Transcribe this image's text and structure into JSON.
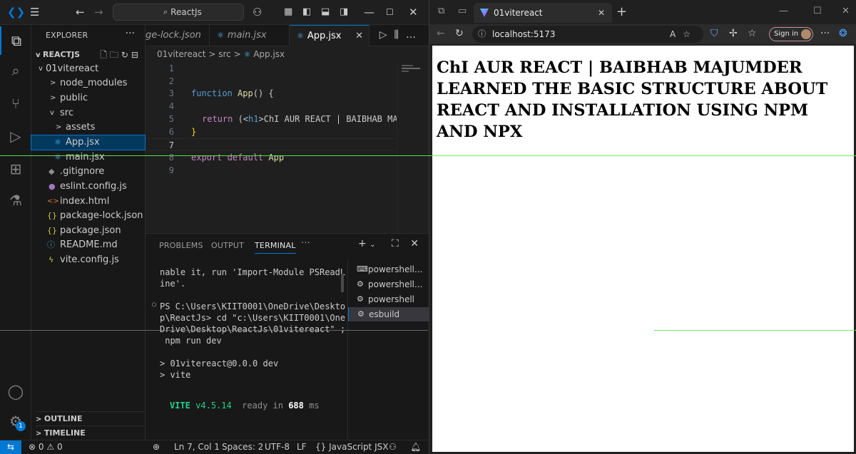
{
  "vscode": {
    "search": "ReactJs",
    "activity_icons": [
      "explorer-icon",
      "search-icon",
      "source-control-icon",
      "run-debug-icon",
      "extensions-icon",
      "testing-icon",
      "account-icon",
      "manage-gear-icon"
    ],
    "manage_badge": "1",
    "explorer": {
      "title": "EXPLORER",
      "more": "···",
      "root": "REACTJS",
      "tree": [
        {
          "label": "01vitereact",
          "chev": "v"
        },
        {
          "label": "node_modules",
          "chev": ">"
        },
        {
          "label": "public",
          "chev": ">"
        },
        {
          "label": "src",
          "chev": "v"
        },
        {
          "label": "assets",
          "chev": ">"
        },
        {
          "label": "App.jsx",
          "icon": "⚛"
        },
        {
          "label": "main.jsx",
          "icon": "⚛"
        },
        {
          "label": ".gitignore",
          "icon": "◆"
        },
        {
          "label": "eslint.config.js",
          "icon": "●"
        },
        {
          "label": "index.html",
          "icon": "<>"
        },
        {
          "label": "package-lock.json",
          "icon": "{}"
        },
        {
          "label": "package.json",
          "icon": "{}"
        },
        {
          "label": "README.md",
          "icon": "ⓘ"
        },
        {
          "label": "vite.config.js",
          "icon": "ϟ"
        }
      ],
      "outline": "OUTLINE",
      "timeline": "TIMELINE"
    },
    "tabs": [
      {
        "label": "ge-lock.json"
      },
      {
        "label": "main.jsx"
      },
      {
        "label": "App.jsx"
      }
    ],
    "breadcrumb": {
      "parts": [
        "01vitereact",
        "src",
        "App.jsx"
      ],
      "sep": ">"
    },
    "code": {
      "line_numbers": [
        "1",
        "2",
        "3",
        "4",
        "5",
        "6",
        "7",
        "8",
        "9"
      ],
      "l3_kw": "function",
      "l3_fn": "App",
      "l3_rest": "() {",
      "l5_kw": "return",
      "l5_rest_a": " (<",
      "l5_tag": "h1",
      "l5_rest_b": ">",
      "l5_text": "ChI AUR REACT | BAIBHAB MA",
      "l6": "}",
      "l8_kw1": "export",
      "l8_kw2": " default",
      "l8_rest": " App"
    },
    "panel": {
      "tabs": [
        "PROBLEMS",
        "OUTPUT",
        "TERMINAL"
      ],
      "more": "···",
      "terminal_lines": [
        "nable it, run 'Import-Module PSReadL",
        "ine'.",
        "",
        "PS C:\\Users\\KIIT0001\\OneDrive\\Deskto",
        "p\\ReactJs> cd \"c:\\Users\\KIIT0001\\One",
        "Drive\\Desktop\\ReactJs\\01vitereact\" ;",
        " npm run dev",
        "",
        "> 01vitereact@0.0.0 dev",
        "> vite"
      ],
      "vite_name": "VITE",
      "vite_version": "v4.5.14",
      "ready_text": "ready in",
      "ready_ms": "688",
      "ready_unit": "ms",
      "terminals": [
        "powershell...",
        "powershell...",
        "powershell",
        "esbuild"
      ]
    },
    "status": {
      "errors": "0",
      "warnings": "0",
      "position": "Ln 7, Col 1",
      "spaces": "Spaces: 2",
      "encoding": "UTF-8",
      "eol": "LF",
      "language": "JavaScript JSX",
      "language_prefix": "{}"
    }
  },
  "browser": {
    "tab_title": "01vitereact",
    "url": "localhost:5173",
    "signin": "Sign in",
    "heading": "ChI AUR REACT | BAIBHAB MAJUMDER LEARNED THE BASIC STRUCTURE ABOUT REACT AND INSTALLATION USING NPM AND NPX"
  },
  "colors": {
    "accent": "#0078d4",
    "editor_bg": "#1f1f1f",
    "keyword": "#569cd6",
    "vite_green": "#23d18b"
  }
}
